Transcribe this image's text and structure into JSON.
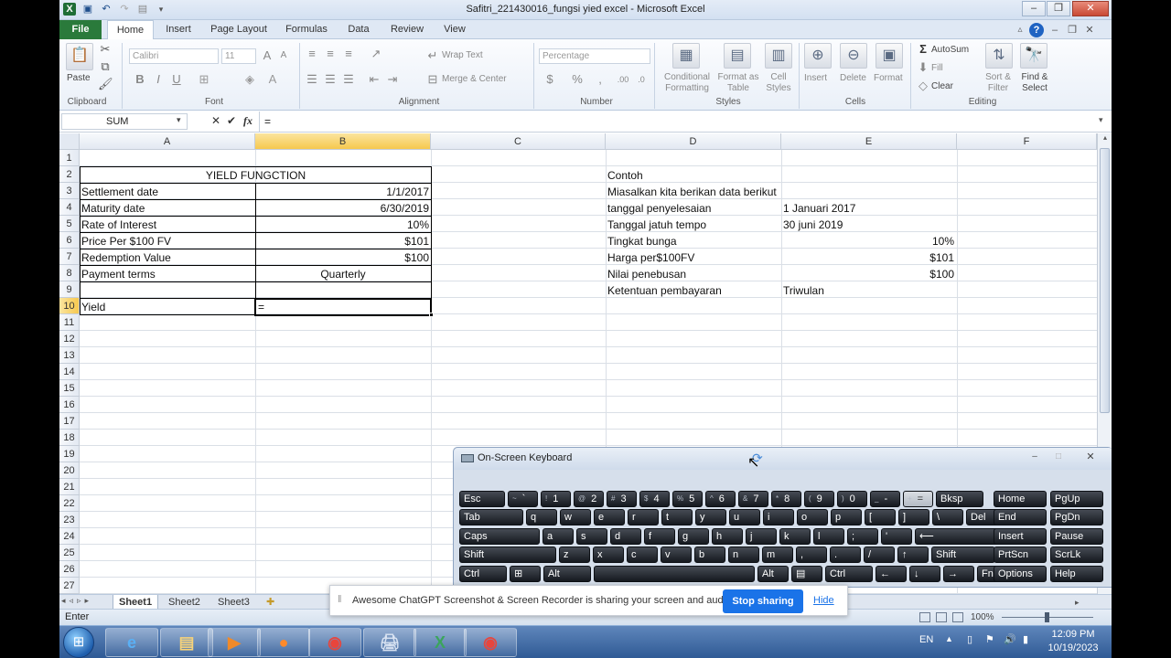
{
  "window": {
    "title": "Safitri_221430016_fungsi yied excel - Microsoft Excel",
    "minimize_icon": "minimize-icon",
    "maximize_icon": "restore-icon",
    "close_icon": "close-icon"
  },
  "ribbon_tabs": [
    "File",
    "Home",
    "Insert",
    "Page Layout",
    "Formulas",
    "Data",
    "Review",
    "View"
  ],
  "ribbon": {
    "clipboard": {
      "paste": "Paste",
      "group": "Clipboard"
    },
    "font": {
      "name": "Calibri",
      "size": "11",
      "group": "Font"
    },
    "alignment": {
      "wrap": "Wrap Text",
      "merge": "Merge & Center",
      "group": "Alignment"
    },
    "number": {
      "format": "Percentage",
      "currency": "$",
      "percent": "%",
      "comma": ",",
      "group": "Number"
    },
    "styles": {
      "conditional": "Conditional Formatting",
      "format_table": "Format as Table",
      "cell_styles": "Cell Styles",
      "group": "Styles"
    },
    "cells": {
      "insert": "Insert",
      "delete": "Delete",
      "format": "Format",
      "group": "Cells"
    },
    "editing": {
      "autosum": "AutoSum",
      "fill": "Fill",
      "clear": "Clear",
      "sort": "Sort & Filter",
      "find": "Find & Select",
      "group": "Editing"
    }
  },
  "formula_bar": {
    "name_box": "SUM",
    "fx": "fx",
    "content": "="
  },
  "columns": [
    "A",
    "B",
    "C",
    "D",
    "E",
    "F"
  ],
  "rows": [
    "1",
    "2",
    "3",
    "4",
    "5",
    "6",
    "7",
    "8",
    "9",
    "10",
    "11",
    "12",
    "13",
    "14",
    "15",
    "16",
    "17",
    "18",
    "19",
    "20",
    "21",
    "22",
    "23",
    "24",
    "25",
    "26",
    "27"
  ],
  "table": {
    "header": "YIELD FUNGCTION",
    "rows": [
      {
        "label": "Settlement date",
        "value": "1/1/2017"
      },
      {
        "label": "Maturity date",
        "value": "6/30/2019"
      },
      {
        "label": "Rate of Interest",
        "value": "10%"
      },
      {
        "label": "Price Per $100 FV",
        "value": "$101"
      },
      {
        "label": "Redemption Value",
        "value": "$100"
      },
      {
        "label": "Payment terms",
        "value": "Quarterly"
      }
    ],
    "yield_label": "Yield",
    "yield_value": "="
  },
  "example": {
    "title": "Contoh",
    "intro": "Miasalkan kita berikan data berikut",
    "rows": [
      {
        "label": "tanggal penyelesaian",
        "value": "1 Januari 2017"
      },
      {
        "label": "Tanggal jatuh tempo",
        "value": "30 juni 2019"
      },
      {
        "label": "Tingkat bunga",
        "value": "10%"
      },
      {
        "label": "Harga per$100FV",
        "value": "$101"
      },
      {
        "label": "Nilai penebusan",
        "value": "$100"
      },
      {
        "label": "Ketentuan pembayaran",
        "value": "Triwulan"
      }
    ]
  },
  "sheets": [
    "Sheet1",
    "Sheet2",
    "Sheet3"
  ],
  "status": {
    "mode": "Enter",
    "zoom": "100%"
  },
  "osk": {
    "title": "On-Screen Keyboard",
    "row1": [
      [
        "Esc",
        ""
      ],
      [
        "~",
        "`"
      ],
      [
        "!",
        "1"
      ],
      [
        "@",
        "2"
      ],
      [
        "#",
        "3"
      ],
      [
        "$",
        "4"
      ],
      [
        "%",
        "5"
      ],
      [
        "^",
        "6"
      ],
      [
        "&",
        "7"
      ],
      [
        "*",
        "8"
      ],
      [
        "(",
        "9"
      ],
      [
        ")",
        "0"
      ],
      [
        "_",
        "-"
      ],
      [
        "+",
        "="
      ],
      [
        "Bksp",
        ""
      ]
    ],
    "row2": [
      "Tab",
      "q",
      "w",
      "e",
      "r",
      "t",
      "y",
      "u",
      "i",
      "o",
      "p",
      "[",
      "]",
      "\\",
      "Del"
    ],
    "row3": [
      "Caps",
      "a",
      "s",
      "d",
      "f",
      "g",
      "h",
      "j",
      "k",
      "l",
      ";",
      "'",
      "⟵"
    ],
    "row4": [
      "Shift",
      "z",
      "x",
      "c",
      "v",
      "b",
      "n",
      "m",
      ",",
      ".",
      "/",
      "↑",
      "Shift"
    ],
    "row5": [
      "Ctrl",
      "⊞",
      "Alt",
      "",
      "Alt",
      "▤",
      "Ctrl",
      "←",
      "↓",
      "→",
      "Fn"
    ],
    "side": [
      [
        "Home",
        "PgUp"
      ],
      [
        "End",
        "PgDn"
      ],
      [
        "Insert",
        "Pause"
      ],
      [
        "PrtScn",
        "ScrLk"
      ],
      [
        "Options",
        "Help"
      ]
    ]
  },
  "notification": {
    "text": "Awesome ChatGPT Screenshot & Screen Recorder is sharing your screen and audio.",
    "stop": "Stop sharing",
    "hide": "Hide"
  },
  "taskbar": {
    "lang": "EN",
    "time": "12:09 PM",
    "date": "10/19/2023",
    "apps": [
      "windows-start-icon",
      "internet-explorer-icon",
      "file-explorer-icon",
      "media-player-icon",
      "firefox-icon",
      "chrome-icon",
      "scanner-icon",
      "excel-icon",
      "chrome-profile-icon"
    ]
  }
}
